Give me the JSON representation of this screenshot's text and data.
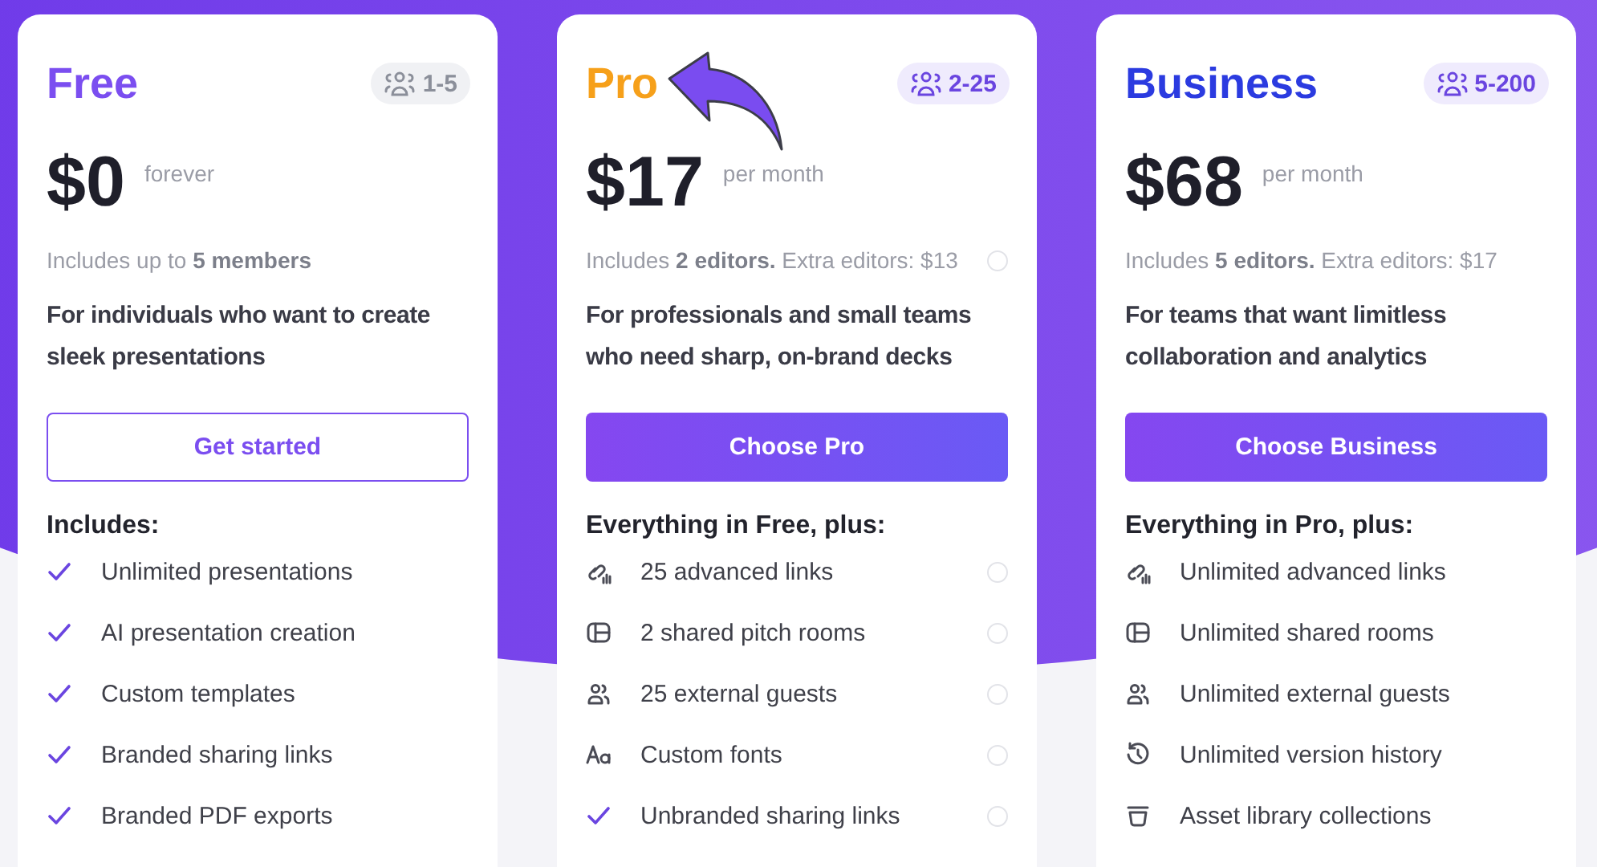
{
  "plans": [
    {
      "name": "Free",
      "color": "#7b4ef0",
      "badge": {
        "text": "1-5",
        "kind": "neutral"
      },
      "price": "$0",
      "period": "forever",
      "includes": "Includes up to **5 members**",
      "description": "For individuals who want to create sleek presentations",
      "button": {
        "label": "Get started",
        "kind": "outline"
      },
      "features_title": "Includes:",
      "features": [
        {
          "kind": "check",
          "text": "Unlimited presentations",
          "info": false
        },
        {
          "kind": "check",
          "text": "AI presentation creation",
          "info": false
        },
        {
          "kind": "check",
          "text": "Custom templates",
          "info": false
        },
        {
          "kind": "check",
          "text": "Branded sharing links",
          "info": false
        },
        {
          "kind": "check",
          "text": "Branded PDF exports",
          "info": false
        }
      ]
    },
    {
      "name": "Pro",
      "color": "#f6a01a",
      "pointer_arrow": true,
      "badge": {
        "text": "2-25",
        "kind": "accent"
      },
      "price": "$17",
      "period": "per month",
      "includes": "Includes **2 editors.** Extra editors: $13",
      "info": true,
      "description": "For professionals and small teams who need sharp, on-brand decks",
      "button": {
        "label": "Choose Pro",
        "kind": "filled"
      },
      "features_title": "Everything in Free, plus:",
      "features": [
        {
          "kind": "link",
          "text": "25 advanced links",
          "info": true
        },
        {
          "kind": "rooms",
          "text": "2 shared pitch rooms",
          "info": true
        },
        {
          "kind": "guests",
          "text": "25 external guests",
          "info": true
        },
        {
          "kind": "fonts",
          "text": "Custom fonts",
          "info": true
        },
        {
          "kind": "check",
          "text": "Unbranded sharing links",
          "info": true
        }
      ]
    },
    {
      "name": "Business",
      "color": "#2b3be0",
      "badge": {
        "text": "5-200",
        "kind": "accent"
      },
      "price": "$68",
      "period": "per month",
      "includes": "Includes **5 editors.** Extra editors: $17",
      "description": "For teams that want limitless collaboration and analytics",
      "button": {
        "label": "Choose Business",
        "kind": "filled"
      },
      "features_title": "Everything in Pro, plus:",
      "features": [
        {
          "kind": "link",
          "text": "Unlimited advanced links",
          "info": false
        },
        {
          "kind": "rooms",
          "text": "Unlimited shared rooms",
          "info": false
        },
        {
          "kind": "guests",
          "text": "Unlimited external guests",
          "info": false
        },
        {
          "kind": "history",
          "text": "Unlimited version history",
          "info": false
        },
        {
          "kind": "library",
          "text": "Asset library collections",
          "info": false
        }
      ]
    }
  ]
}
